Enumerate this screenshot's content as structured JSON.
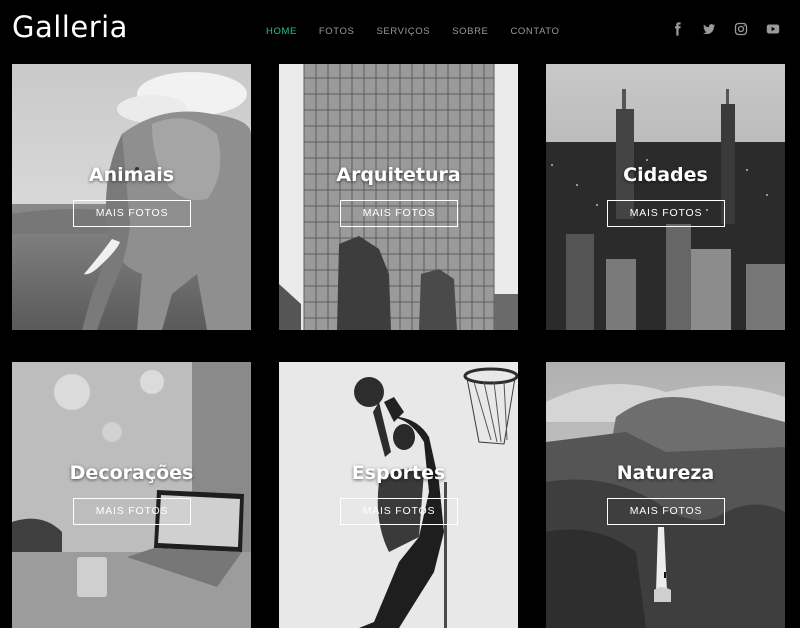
{
  "brand": {
    "logo": "Galleria"
  },
  "nav": {
    "items": [
      {
        "label": "HOME",
        "active": true
      },
      {
        "label": "FOTOS",
        "active": false
      },
      {
        "label": "SERVIÇOS",
        "active": false
      },
      {
        "label": "SOBRE",
        "active": false
      },
      {
        "label": "CONTATO",
        "active": false
      }
    ]
  },
  "social": {
    "icons": [
      "facebook-icon",
      "twitter-icon",
      "instagram-icon",
      "youtube-icon"
    ]
  },
  "colors": {
    "accent": "#2fbf8f",
    "background": "#000000",
    "nav_text": "#9a9a9a"
  },
  "gallery": {
    "tiles": [
      {
        "title": "Animais",
        "button": "MAIS FOTOS"
      },
      {
        "title": "Arquitetura",
        "button": "MAIS FOTOS"
      },
      {
        "title": "Cidades",
        "button": "MAIS FOTOS"
      },
      {
        "title": "Decorações",
        "button": "MAIS FOTOS"
      },
      {
        "title": "Esportes",
        "button": "MAIS FOTOS"
      },
      {
        "title": "Natureza",
        "button": "MAIS FOTOS"
      }
    ]
  }
}
